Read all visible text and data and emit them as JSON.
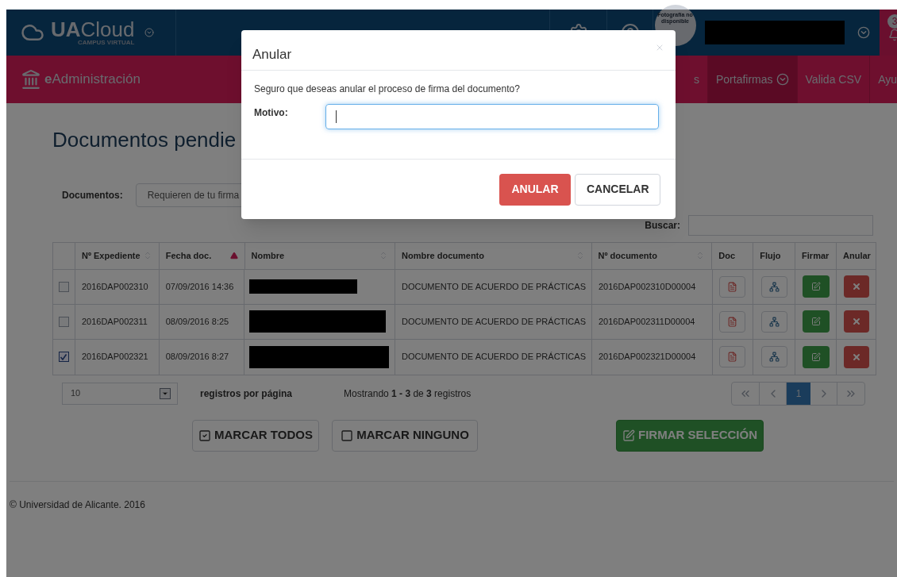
{
  "header": {
    "brand_bold": "UA",
    "brand_rest": "Cloud",
    "brand_sub": "CAMPUS VIRTUAL",
    "avatar_text": "Fotografía no disponible",
    "notification_count": "3"
  },
  "nav": {
    "app_bold": "e",
    "app_rest": "Administración",
    "items": [
      {
        "label": "s",
        "selected": false,
        "has_menu": false
      },
      {
        "label": "Portafirmas",
        "selected": true,
        "has_menu": true
      },
      {
        "label": "Valida CSV",
        "selected": false,
        "has_menu": false
      },
      {
        "label": "Ayu",
        "selected": false,
        "has_menu": false
      }
    ]
  },
  "page": {
    "title": "Documentos pendie",
    "filter_label": "Documentos:",
    "filter_value": "Requieren de tu firma",
    "search_label": "Buscar:"
  },
  "table": {
    "columns": [
      {
        "label": "Nº Expediente",
        "sortable": true,
        "sorted": false
      },
      {
        "label": "Fecha doc.",
        "sortable": true,
        "sorted": true
      },
      {
        "label": "Nombre",
        "sortable": true,
        "sorted": false
      },
      {
        "label": "Nombre documento",
        "sortable": true,
        "sorted": false
      },
      {
        "label": "Nº documento",
        "sortable": true,
        "sorted": false
      },
      {
        "label": "Doc",
        "sortable": false
      },
      {
        "label": "Flujo",
        "sortable": false
      },
      {
        "label": "Firmar",
        "sortable": false
      },
      {
        "label": "Anular",
        "sortable": false
      }
    ],
    "rows": [
      {
        "checked": false,
        "expediente": "2016DAP002310",
        "fecha": "07/09/2016 14:36",
        "documento": "DOCUMENTO DE ACUERDO DE PRÁCTICAS",
        "numero": "2016DAP002310D00004"
      },
      {
        "checked": false,
        "expediente": "2016DAP002311",
        "fecha": "08/09/2016 8:25",
        "documento": "DOCUMENTO DE ACUERDO DE PRÁCTICAS",
        "numero": "2016DAP002311D00004"
      },
      {
        "checked": true,
        "expediente": "2016DAP002321",
        "fecha": "08/09/2016 8:27",
        "documento": "DOCUMENTO DE ACUERDO DE PRÁCTICAS",
        "numero": "2016DAP002321D00004"
      }
    ]
  },
  "pager": {
    "page_size": "10",
    "page_size_label": "registros por página",
    "summary": "Mostrando **1 - 3** de **3** registros",
    "pages": [
      {
        "label": "1",
        "selected": true
      }
    ]
  },
  "actions": [
    {
      "label": "MARCAR TODOS",
      "kind": "check-all"
    },
    {
      "label": "MARCAR NINGUNO",
      "kind": "check-none"
    },
    {
      "label": "FIRMAR SELECCIÓN",
      "kind": "sign"
    }
  ],
  "footer": "© Universidad de Alicante. 2016",
  "modal": {
    "title": "Anular",
    "message": "Seguro que deseas anular el proceso de firma del documento?",
    "field_label": "Motivo:",
    "field_focused": true,
    "buttons": [
      {
        "label": "ANULAR",
        "kind": "danger"
      },
      {
        "label": "CANCELAR",
        "kind": "default"
      }
    ]
  }
}
